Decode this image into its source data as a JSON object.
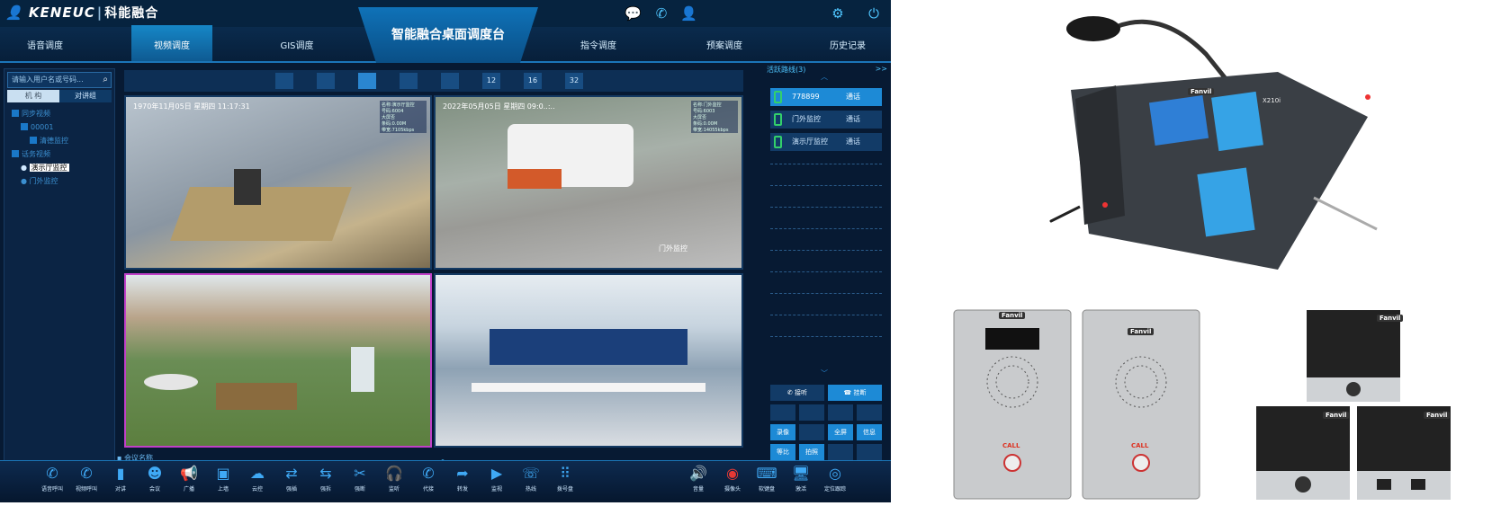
{
  "app": {
    "brand_logo": "KENEUC",
    "brand_name": "科能融合",
    "title": "智能融合桌面调度台"
  },
  "nav": {
    "tabs": [
      {
        "label": "语音调度"
      },
      {
        "label": "视频调度",
        "active": true
      },
      {
        "label": "GIS调度"
      },
      {
        "label": "指令调度"
      },
      {
        "label": "预案调度"
      },
      {
        "label": "历史记录"
      }
    ]
  },
  "left_panel": {
    "search_placeholder": "请输入用户名或号码...",
    "tabs": [
      "机  构",
      "对讲组"
    ],
    "tree": [
      {
        "label": "同步视频",
        "level": 0
      },
      {
        "label": "00001",
        "level": 1
      },
      {
        "label": "清德监控",
        "level": 2
      },
      {
        "label": "话务视频",
        "level": 0
      },
      {
        "label": "演示厅监控",
        "level": 1,
        "highlight": true
      },
      {
        "label": "门外监控",
        "level": 1
      }
    ]
  },
  "video_grid": {
    "layout_buttons": [
      "",
      "",
      "",
      "",
      "",
      "12",
      "16",
      "32"
    ],
    "cells": [
      {
        "timestamp": "1970年11月05日 星期四 11:17:31",
        "info": [
          "名称:演示厅监控",
          "号码:6004",
          "大屏否",
          "条码:0.00M",
          "带宽:7105kbps"
        ]
      },
      {
        "timestamp": "2022年05月05日 星期四 09:0..:..",
        "info": [
          "名称:门外监控",
          "号码:6003",
          "大屏否",
          "条码:0.00M",
          "带宽:14055kbps"
        ],
        "label": "门外监控"
      },
      {
        "timestamp": "",
        "info": []
      },
      {
        "timestamp": "",
        "info": []
      }
    ]
  },
  "right_panel": {
    "title": "活跃路线(3)",
    "more": ">>",
    "calls": [
      {
        "number": "778899",
        "status": "通话"
      },
      {
        "number": "门外监控",
        "status": "通话"
      },
      {
        "number": "演示厅监控",
        "status": "通话"
      }
    ],
    "actions": [
      "接听",
      "挂断",
      "录像",
      "",
      "全屏",
      "信息",
      "等比",
      "拍照"
    ]
  },
  "bottom": {
    "meeting_label": "会议名称",
    "tools_left": [
      {
        "label": "语音呼叫",
        "icon": "phone-forward-icon"
      },
      {
        "label": "视频呼叫",
        "icon": "video-call-icon"
      },
      {
        "label": "对讲",
        "icon": "walkie-talkie-icon"
      },
      {
        "label": "会议",
        "icon": "meeting-icon"
      },
      {
        "label": "广播",
        "icon": "broadcast-icon"
      },
      {
        "label": "上墙",
        "icon": "video-wall-icon"
      },
      {
        "label": "云控",
        "icon": "cloud-control-icon"
      },
      {
        "label": "强插",
        "icon": "force-insert-icon"
      },
      {
        "label": "强拆",
        "icon": "force-remove-icon"
      },
      {
        "label": "强断",
        "icon": "force-disconnect-icon"
      },
      {
        "label": "监听",
        "icon": "headset-icon"
      },
      {
        "label": "代接",
        "icon": "call-pickup-icon"
      },
      {
        "label": "转发",
        "icon": "forward-icon"
      },
      {
        "label": "监视",
        "icon": "monitor-icon"
      },
      {
        "label": "热线",
        "icon": "hotline-icon"
      },
      {
        "label": "拨号盘",
        "icon": "dialpad-icon"
      }
    ],
    "tools_right": [
      {
        "label": "音量",
        "icon": "volume-icon"
      },
      {
        "label": "摄像头",
        "icon": "camera-icon"
      },
      {
        "label": "软键盘",
        "icon": "keyboard-icon"
      },
      {
        "label": "激活",
        "icon": "activate-icon"
      },
      {
        "label": "定位跟踪",
        "icon": "locate-icon"
      }
    ]
  },
  "product": {
    "brand": "Fanvil",
    "model": "X210i",
    "call_label": "CALL"
  }
}
